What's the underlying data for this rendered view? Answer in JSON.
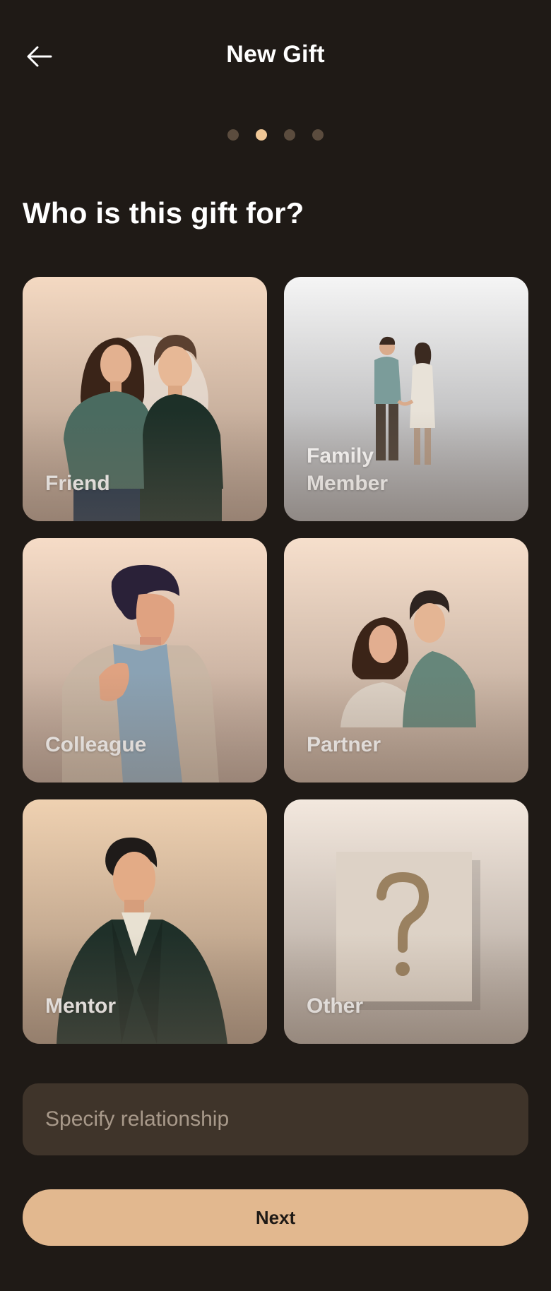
{
  "header": {
    "title": "New Gift"
  },
  "steps": {
    "total": 4,
    "current": 2
  },
  "question": "Who is this gift for?",
  "cards": [
    {
      "id": "friend",
      "label": "Friend"
    },
    {
      "id": "family",
      "label": "Family\nMember"
    },
    {
      "id": "colleague",
      "label": "Colleague"
    },
    {
      "id": "partner",
      "label": "Partner"
    },
    {
      "id": "mentor",
      "label": "Mentor"
    },
    {
      "id": "other",
      "label": "Other"
    }
  ],
  "relationship_input": {
    "placeholder": "Specify relationship",
    "value": ""
  },
  "next_button": {
    "label": "Next"
  },
  "colors": {
    "background": "#1f1a16",
    "accent": "#e2b88f",
    "dot_active": "#f0c796",
    "dot_inactive": "#5b4c3e",
    "input_bg": "#3f342a"
  }
}
